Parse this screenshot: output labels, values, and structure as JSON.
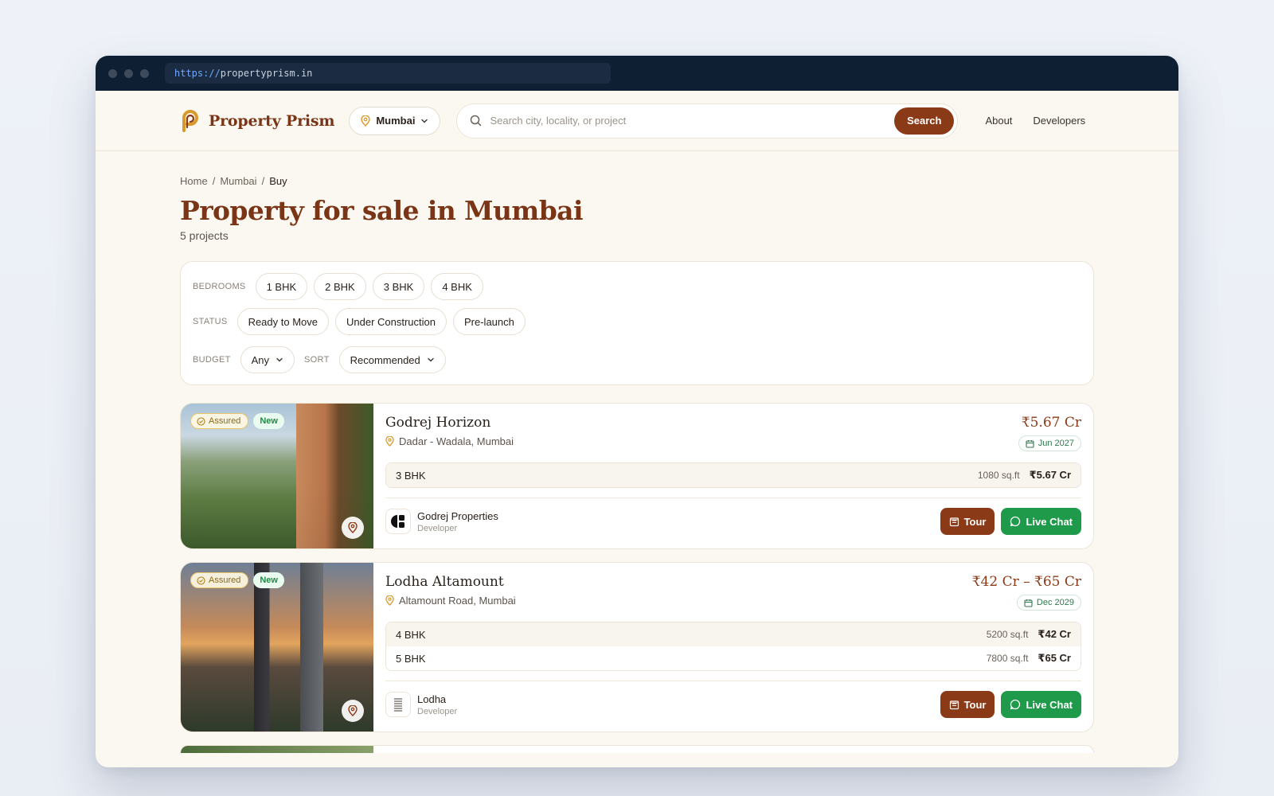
{
  "browser": {
    "url_scheme": "https://",
    "url_host": "propertyprism.in"
  },
  "header": {
    "brand": "Property Prism",
    "city": "Mumbai",
    "search_placeholder": "Search city, locality, or project",
    "search_label": "Search",
    "nav": [
      "About",
      "Developers"
    ]
  },
  "breadcrumb": [
    "Home",
    "Mumbai",
    "Buy"
  ],
  "page": {
    "title": "Property for sale in Mumbai",
    "count": "5 projects"
  },
  "filters": {
    "bedrooms_label": "BEDROOMS",
    "bedrooms": [
      "1 BHK",
      "2 BHK",
      "3 BHK",
      "4 BHK"
    ],
    "status_label": "STATUS",
    "status": [
      "Ready to Move",
      "Under Construction",
      "Pre-launch"
    ],
    "budget_label": "BUDGET",
    "budget_value": "Any",
    "sort_label": "SORT",
    "sort_value": "Recommended"
  },
  "listings": [
    {
      "badge_assured": "Assured",
      "badge_new": "New",
      "name": "Godrej Horizon",
      "location": "Dadar - Wadala, Mumbai",
      "price": "₹5.67 Cr",
      "possession": "Jun 2027",
      "configs": [
        {
          "bhk": "3 BHK",
          "sqft": "1080 sq.ft",
          "price": "₹5.67 Cr"
        }
      ],
      "developer": "Godrej Properties",
      "developer_role": "Developer",
      "tour_label": "Tour",
      "chat_label": "Live Chat"
    },
    {
      "badge_assured": "Assured",
      "badge_new": "New",
      "name": "Lodha Altamount",
      "location": "Altamount Road, Mumbai",
      "price": "₹42 Cr – ₹65 Cr",
      "possession": "Dec 2029",
      "configs": [
        {
          "bhk": "4 BHK",
          "sqft": "5200 sq.ft",
          "price": "₹42 Cr"
        },
        {
          "bhk": "5 BHK",
          "sqft": "7800 sq.ft",
          "price": "₹65 Cr"
        }
      ],
      "developer": "Lodha",
      "developer_role": "Developer",
      "tour_label": "Tour",
      "chat_label": "Live Chat"
    }
  ],
  "colors": {
    "brand": "#8b3a17",
    "chat": "#1f9a4a",
    "background": "#fbf8f1",
    "chrome": "#0f1f33"
  },
  "icons": {
    "location": "map-pin-icon",
    "search": "search-icon",
    "calendar": "calendar-icon",
    "chevron": "chevron-down-icon",
    "tour": "building-icon",
    "chat": "chat-bubble-icon"
  }
}
